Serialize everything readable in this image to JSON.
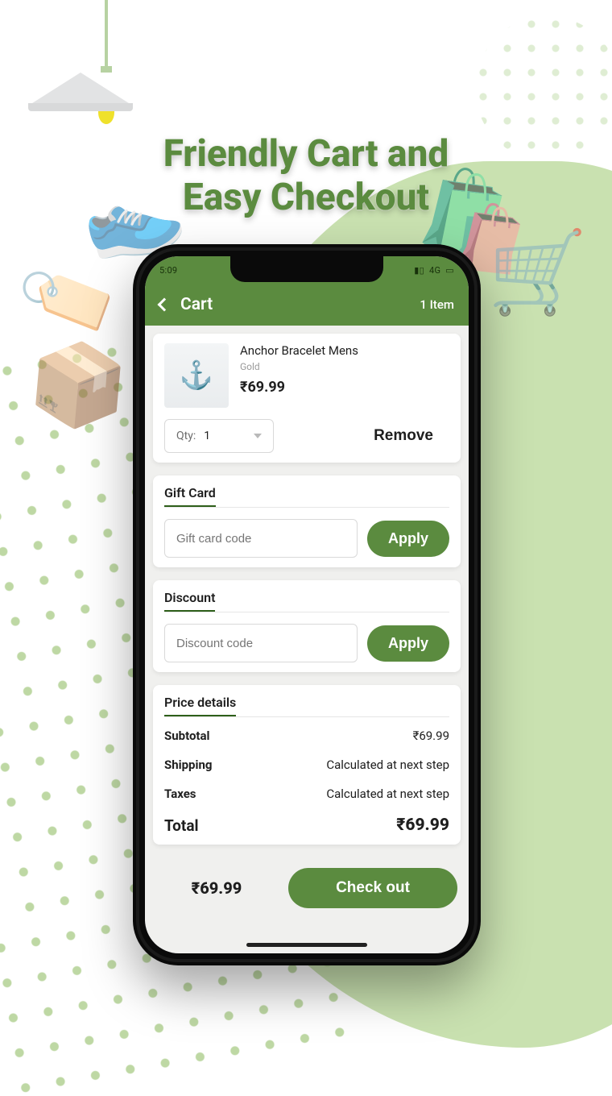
{
  "headline_line1": "Friendly Cart and",
  "headline_line2": "Easy Checkout",
  "statusbar": {
    "time": "5:09",
    "net": "4G"
  },
  "appbar": {
    "title": "Cart",
    "count": "1 Item"
  },
  "item": {
    "name": "Anchor Bracelet Mens",
    "variant": "Gold",
    "price": "₹69.99",
    "qty_label": "Qty:",
    "qty_value": "1",
    "remove_label": "Remove"
  },
  "giftcard": {
    "title": "Gift Card",
    "placeholder": "Gift card code",
    "apply": "Apply"
  },
  "discount": {
    "title": "Discount",
    "placeholder": "Discount code",
    "apply": "Apply"
  },
  "price": {
    "title": "Price details",
    "subtotal_label": "Subtotal",
    "subtotal_value": "₹69.99",
    "shipping_label": "Shipping",
    "shipping_value": "Calculated at next step",
    "taxes_label": "Taxes",
    "taxes_value": "Calculated at next step",
    "total_label": "Total",
    "total_value": "₹69.99"
  },
  "footer": {
    "total": "₹69.99",
    "checkout": "Check out"
  }
}
